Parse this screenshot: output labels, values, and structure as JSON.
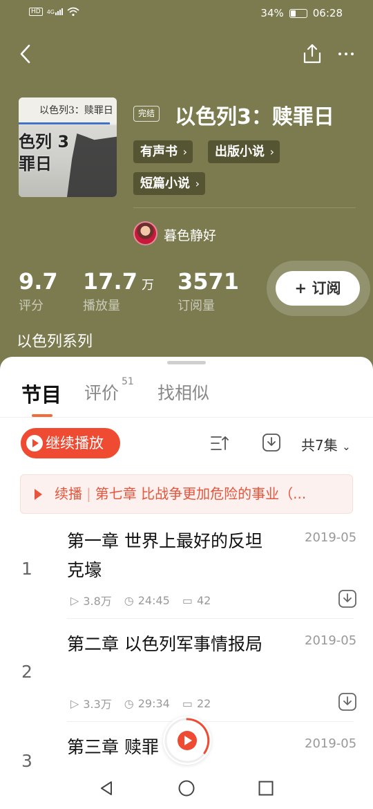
{
  "status_bar": {
    "left_icons": [
      "hd-icon",
      "signal-icon",
      "wifi-icon"
    ],
    "network_label": "HD",
    "network_type": "4G",
    "battery_percent": "34%",
    "battery_level": 0.34,
    "time": "06:28"
  },
  "book": {
    "status_badge": "完结",
    "title": "以色列3：赎罪日",
    "cover_caption": "以色列3：赎罪日",
    "cover_overlay": "色列 3\n罪日",
    "tags": [
      "有声书",
      "出版小说",
      "短篇小说"
    ],
    "author": "暮色静好",
    "series": "以色列系列"
  },
  "stats": [
    {
      "value": "9.7",
      "unit": "",
      "label": "评分"
    },
    {
      "value": "17.7",
      "unit": "万",
      "label": "播放量"
    },
    {
      "value": "3571",
      "unit": "",
      "label": "订阅量"
    }
  ],
  "subscribe_label": "+ 订阅",
  "tabs": [
    {
      "label": "节目",
      "badge": ""
    },
    {
      "label": "评价",
      "badge": "51"
    },
    {
      "label": "找相似",
      "badge": ""
    }
  ],
  "toolbar": {
    "continue_label": "继续播放",
    "episodes_count": "共7集"
  },
  "resume": {
    "prefix": "续播",
    "text": "第七章 比战争更加危险的事业（..."
  },
  "episodes": [
    {
      "num": "1",
      "title": "第一章 世界上最好的反坦克壕",
      "date": "2019-05",
      "plays": "3.8万",
      "duration": "24:45",
      "comments": "42"
    },
    {
      "num": "2",
      "title": "第二章 以色列军事情报局",
      "date": "2019-05",
      "plays": "3.3万",
      "duration": "29:34",
      "comments": "22"
    },
    {
      "num": "3",
      "title": "第三章 赎罪",
      "date": "2019-05",
      "plays": "",
      "duration": "",
      "comments": ""
    }
  ],
  "colors": {
    "header_bg": "#7b7b4f",
    "accent": "#ef4a32",
    "tab_indicator": "#f26b3a"
  }
}
